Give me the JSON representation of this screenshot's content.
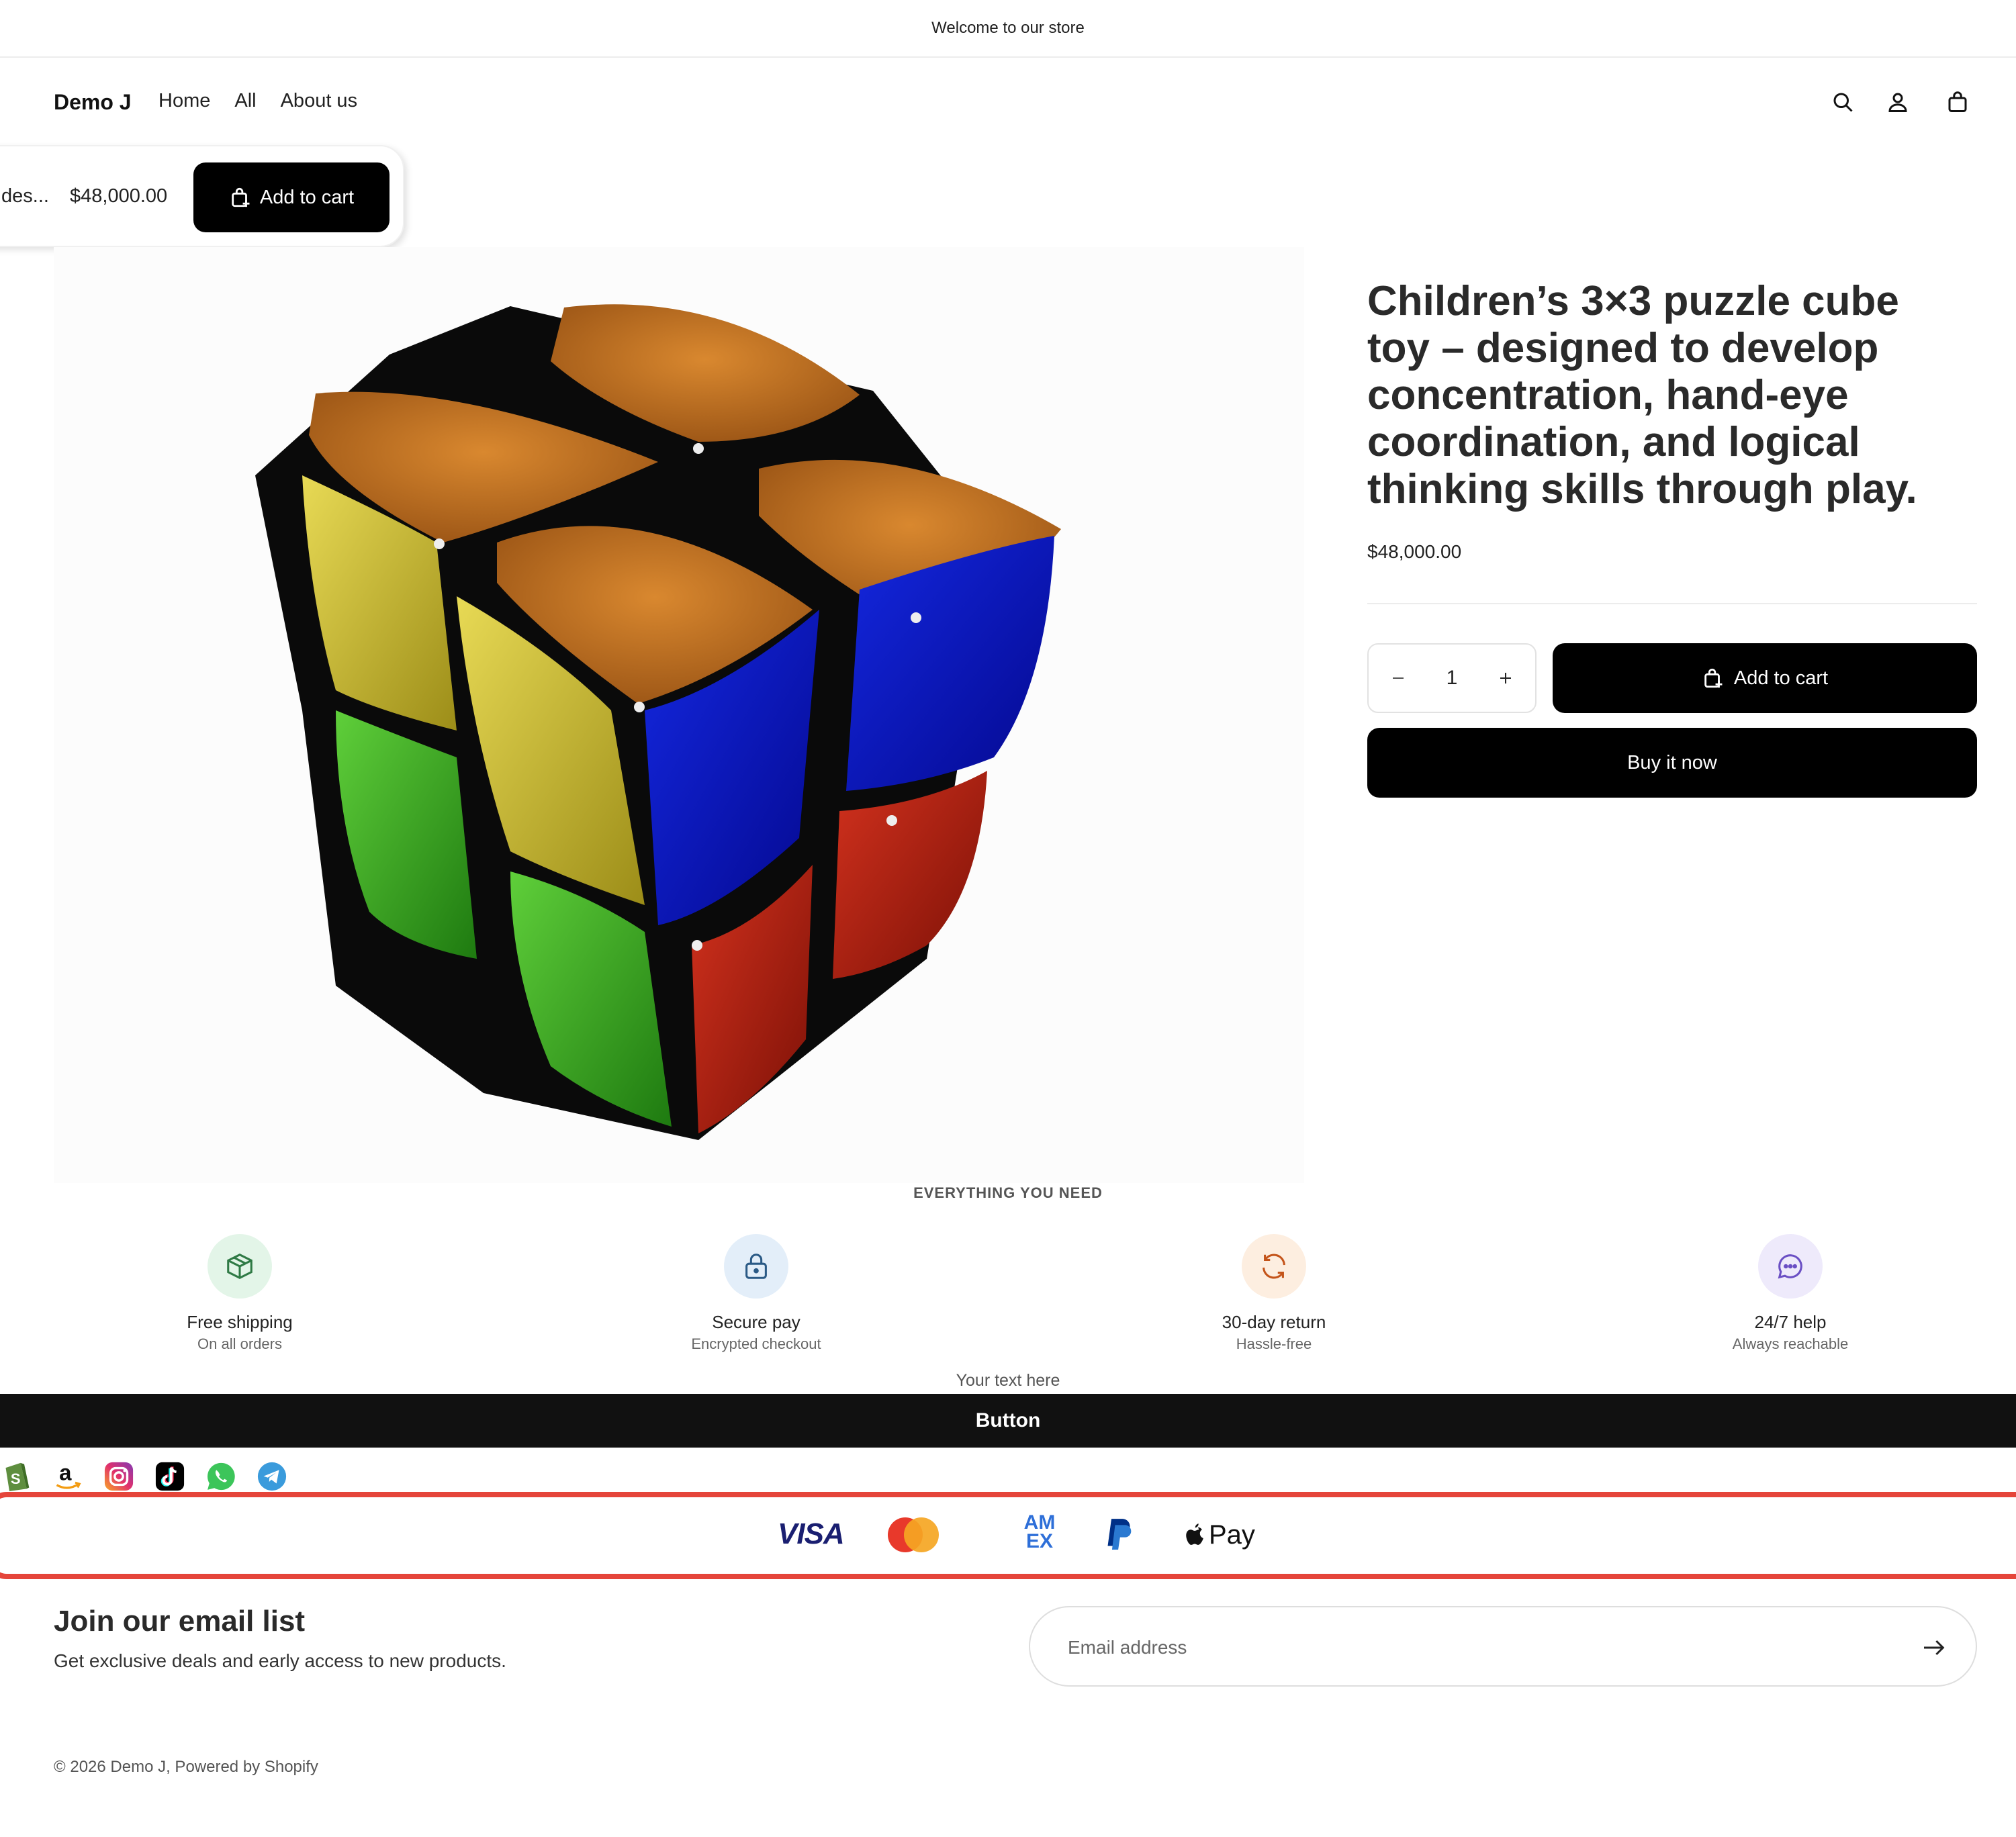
{
  "announcement": {
    "text": "Welcome to our store"
  },
  "header": {
    "logo": "Demo J",
    "nav": [
      "Home",
      "All",
      "About us"
    ],
    "icons": [
      "search-icon",
      "account-icon",
      "cart-icon"
    ]
  },
  "sticky_bar": {
    "title_truncated": "des...",
    "price": "$48,000.00",
    "add_to_cart": "Add to cart"
  },
  "product": {
    "title": "Children’s 3×3 puzzle cube toy – designed to develop concentration, hand-eye coordination, and logical thinking skills through play.",
    "price": "$48,000.00",
    "quantity": "1",
    "add_to_cart": "Add to cart",
    "buy_now": "Buy it now"
  },
  "features": {
    "label": "EVERYTHING YOU NEED",
    "items": [
      {
        "title": "Free shipping",
        "subtitle": "On all orders",
        "icon": "package-icon",
        "bg": "#e3f5e8",
        "color": "#2f7a45"
      },
      {
        "title": "Secure pay",
        "subtitle": "Encrypted checkout",
        "icon": "lock-icon",
        "bg": "#e3eef9",
        "color": "#2b5a86"
      },
      {
        "title": "30-day return",
        "subtitle": "Hassle-free",
        "icon": "refresh-icon",
        "bg": "#fdeee0",
        "color": "#c4541a"
      },
      {
        "title": "24/7 help",
        "subtitle": "Always reachable",
        "icon": "chat-icon",
        "bg": "#eeeafb",
        "color": "#6a4fc4"
      }
    ]
  },
  "promo": {
    "text": "Your text here",
    "button": "Button"
  },
  "social": [
    "shopify-icon",
    "amazon-icon",
    "instagram-icon",
    "tiktok-icon",
    "whatsapp-icon",
    "telegram-icon"
  ],
  "payments": {
    "visa": "VISA",
    "amex_top": "AM",
    "amex_bottom": "EX",
    "apple_pay": "Pay"
  },
  "newsletter": {
    "title": "Join our email list",
    "subtitle": "Get exclusive deals and early access to new products.",
    "placeholder": "Email address"
  },
  "footer": {
    "copyright": "© 2026 Demo J, Powered by Shopify"
  },
  "colors": {
    "accent": "#000000",
    "payments_border": "#e5453a"
  }
}
